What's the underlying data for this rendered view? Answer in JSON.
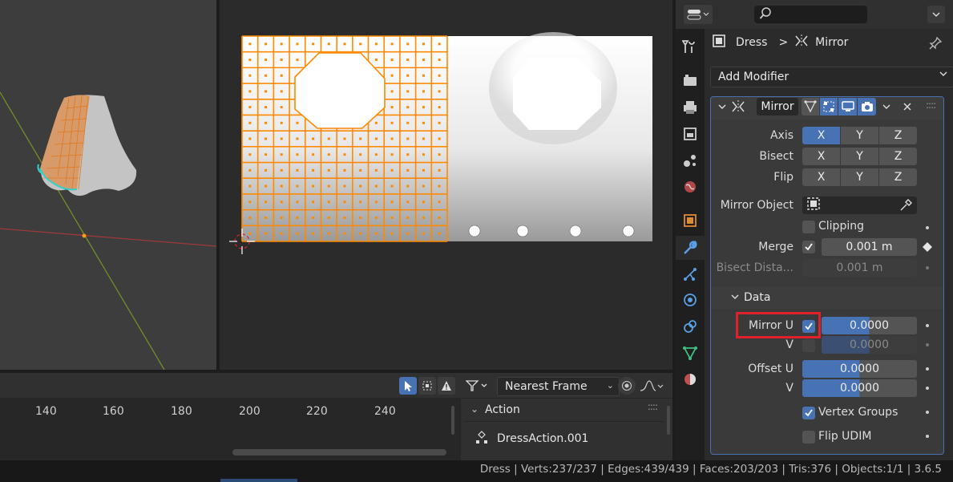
{
  "uv_editor": {
    "snap_mode": "Nearest Frame"
  },
  "timeline": {
    "frame_ticks": [
      "140",
      "160",
      "180",
      "200",
      "220",
      "240"
    ],
    "action_panel": {
      "title": "Action",
      "action_name": "DressAction.001"
    }
  },
  "properties": {
    "breadcrumb": {
      "object": "Dress",
      "separator": ">",
      "modifier": "Mirror"
    },
    "add_modifier_label": "Add Modifier",
    "modifier": {
      "name": "Mirror",
      "axis": {
        "label": "Axis",
        "x": "X",
        "y": "Y",
        "z": "Z",
        "active": "X"
      },
      "bisect": {
        "label": "Bisect",
        "x": "X",
        "y": "Y",
        "z": "Z"
      },
      "flip": {
        "label": "Flip",
        "x": "X",
        "y": "Y",
        "z": "Z"
      },
      "mirror_object_label": "Mirror Object",
      "clipping_label": "Clipping",
      "clipping": false,
      "merge_label": "Merge",
      "merge": true,
      "merge_value": "0.001 m",
      "bisect_distance_label": "Bisect Dista...",
      "bisect_distance_value": "0.001 m",
      "data_section": {
        "title": "Data",
        "mirror_u_label": "Mirror U",
        "mirror_u": true,
        "mirror_u_value": "0.0000",
        "v_label": "V",
        "mirror_v": false,
        "mirror_v_value": "0.0000",
        "offset_u_label": "Offset U",
        "offset_u_value": "0.0000",
        "offset_v_label": "V",
        "offset_v_value": "0.0000",
        "vertex_groups_label": "Vertex Groups",
        "vertex_groups": true,
        "flip_udim_label": "Flip UDIM",
        "flip_udim": false
      }
    }
  },
  "statusbar": {
    "text": "Dress | Verts:237/237 | Edges:439/439 | Faces:203/203 | Tris:376 | Objects:1/1 | 3.6.5"
  },
  "colors": {
    "accent_blue": "#4772b3",
    "highlight_red": "#e0202a",
    "uv_orange": "#ff8a00"
  }
}
